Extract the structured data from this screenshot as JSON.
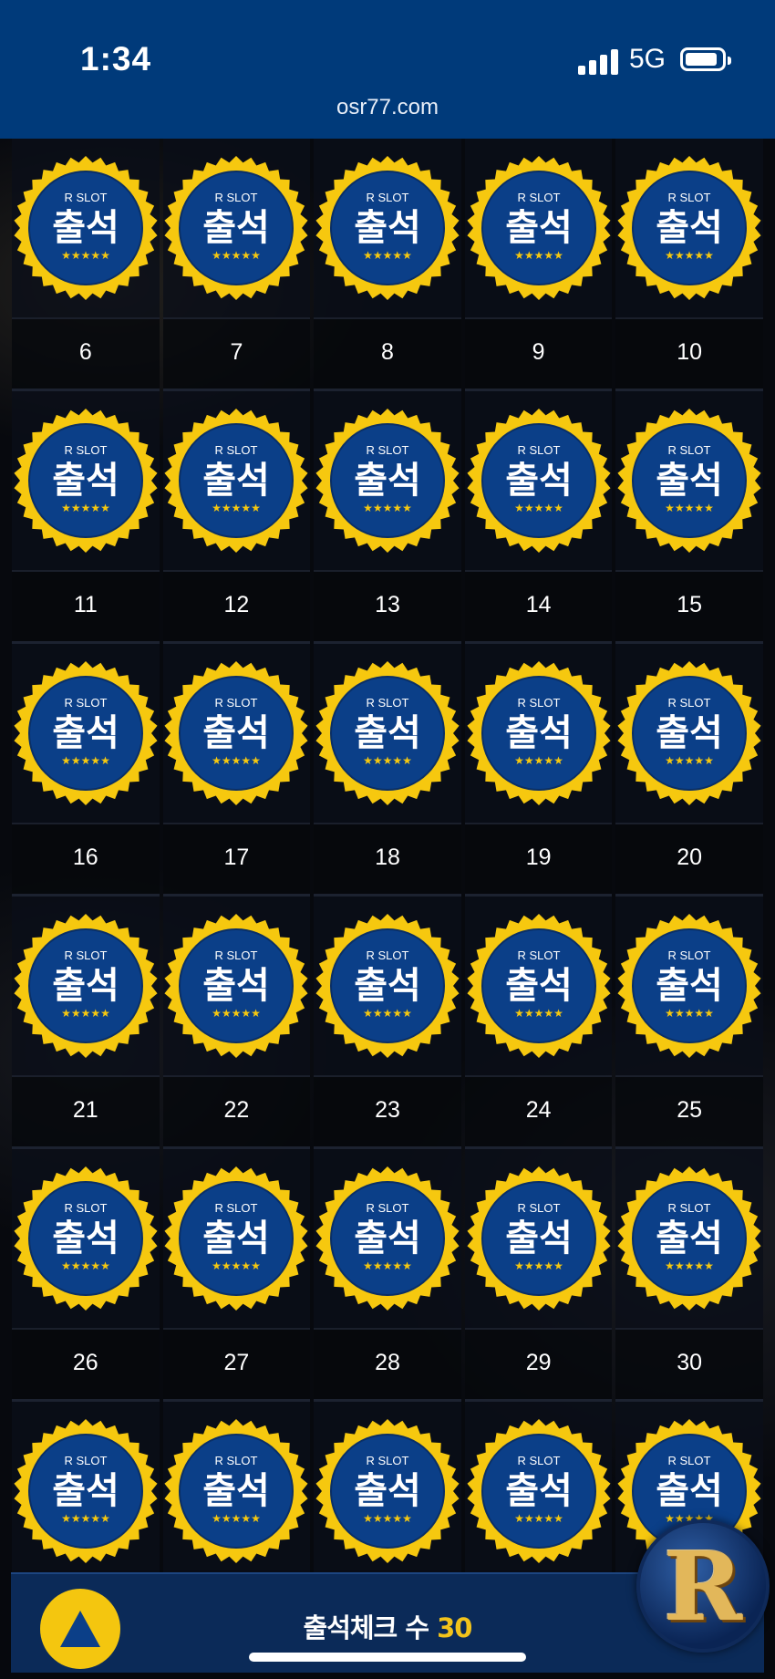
{
  "status_bar": {
    "time": "1:34",
    "network": "5G",
    "url": "osr77.com"
  },
  "badge": {
    "brand": "R SLOT",
    "label": "출석",
    "stars": "★★★★★",
    "colors": {
      "ring": "#f6c80f",
      "inner": "#0b3f88"
    }
  },
  "calendar": {
    "row_labels": [
      [
        "6",
        "7",
        "8",
        "9",
        "10"
      ],
      [
        "11",
        "12",
        "13",
        "14",
        "15"
      ],
      [
        "16",
        "17",
        "18",
        "19",
        "20"
      ],
      [
        "21",
        "22",
        "23",
        "24",
        "25"
      ],
      [
        "26",
        "27",
        "28",
        "29",
        "30"
      ]
    ]
  },
  "footer": {
    "count_label": "출석체크 수",
    "count_value": "30",
    "logo_letter": "R"
  }
}
